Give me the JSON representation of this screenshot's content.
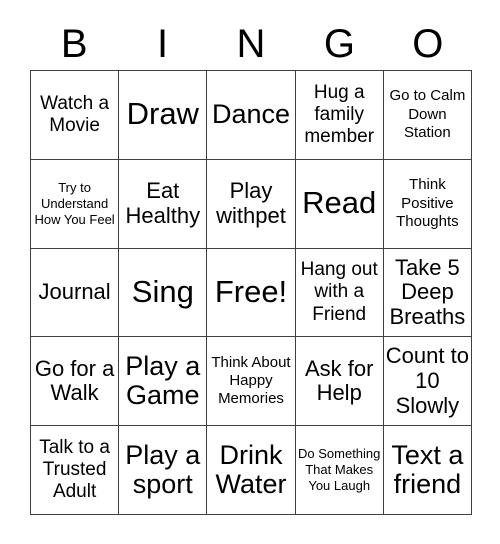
{
  "card": {
    "title": "BINGO Card",
    "columns": [
      "B",
      "I",
      "N",
      "G",
      "O"
    ],
    "grid_size": "5x5"
  },
  "header": {
    "letters": [
      {
        "label": "B"
      },
      {
        "label": "I"
      },
      {
        "label": "N"
      },
      {
        "label": "G"
      },
      {
        "label": "O"
      }
    ]
  },
  "cells": [
    {
      "text": "Watch a Movie",
      "size": "md",
      "free": false
    },
    {
      "text": "Draw",
      "size": "xxl",
      "free": false
    },
    {
      "text": "Dance",
      "size": "xl",
      "free": false
    },
    {
      "text": "Hug a family member",
      "size": "md",
      "free": false
    },
    {
      "text": "Go to Calm Down Station",
      "size": "sm",
      "free": false
    },
    {
      "text": "Try to Understand How You Feel",
      "size": "xs",
      "free": false
    },
    {
      "text": "Eat Healthy",
      "size": "lg",
      "free": false
    },
    {
      "text": "Play withpet",
      "size": "lg",
      "free": false
    },
    {
      "text": "Read",
      "size": "xxl",
      "free": false
    },
    {
      "text": "Think Positive Thoughts",
      "size": "sm",
      "free": false
    },
    {
      "text": "Journal",
      "size": "lg",
      "free": false
    },
    {
      "text": "Sing",
      "size": "xxl",
      "free": false
    },
    {
      "text": "Free!",
      "size": "xxl",
      "free": true
    },
    {
      "text": "Hang out with a Friend",
      "size": "md",
      "free": false
    },
    {
      "text": "Take 5 Deep Breaths",
      "size": "lg",
      "free": false
    },
    {
      "text": "Go for a Walk",
      "size": "lg",
      "free": false
    },
    {
      "text": "Play a Game",
      "size": "xl",
      "free": false
    },
    {
      "text": "Think About Happy Memories",
      "size": "sm",
      "free": false
    },
    {
      "text": "Ask for Help",
      "size": "lg",
      "free": false
    },
    {
      "text": "Count to 10 Slowly",
      "size": "lg",
      "free": false
    },
    {
      "text": "Talk to a Trusted Adult",
      "size": "md",
      "free": false
    },
    {
      "text": "Play a sport",
      "size": "xl",
      "free": false
    },
    {
      "text": "Drink Water",
      "size": "xl",
      "free": false
    },
    {
      "text": "Do Something That Makes You Laugh",
      "size": "xs",
      "free": false
    },
    {
      "text": "Text a friend",
      "size": "xl",
      "free": false
    }
  ],
  "colors": {
    "background": "#ffffff",
    "text": "#000000",
    "grid_line": "#404040"
  }
}
